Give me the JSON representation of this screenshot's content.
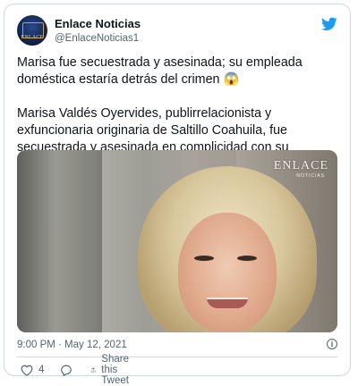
{
  "account": {
    "name": "Enlace Noticias",
    "handle": "@EnlaceNoticias1",
    "avatar_text": "ENLACE"
  },
  "tweet": {
    "paragraph1": "Marisa fue secuestrada y asesinada; su empleada doméstica estaría detrás del crimen 😱",
    "paragraph2": "Marisa Valdés Oyervides, publirrelacionista y exfuncionaria originaria de Saltillo Coahuila, fue secuestrada y asesinada en complicidad con su empleada doméstica"
  },
  "media": {
    "watermark": "ENLACE",
    "watermark_sub": "NOTICIAS"
  },
  "meta": {
    "timestamp": "9:00 PM · May 12, 2021",
    "info_glyph": "i"
  },
  "actions": {
    "like_count": "4",
    "share_label": "Share this Tweet"
  },
  "colors": {
    "twitter_blue": "#1d9bf0",
    "muted_text": "#536471",
    "border": "#cfd9de"
  }
}
